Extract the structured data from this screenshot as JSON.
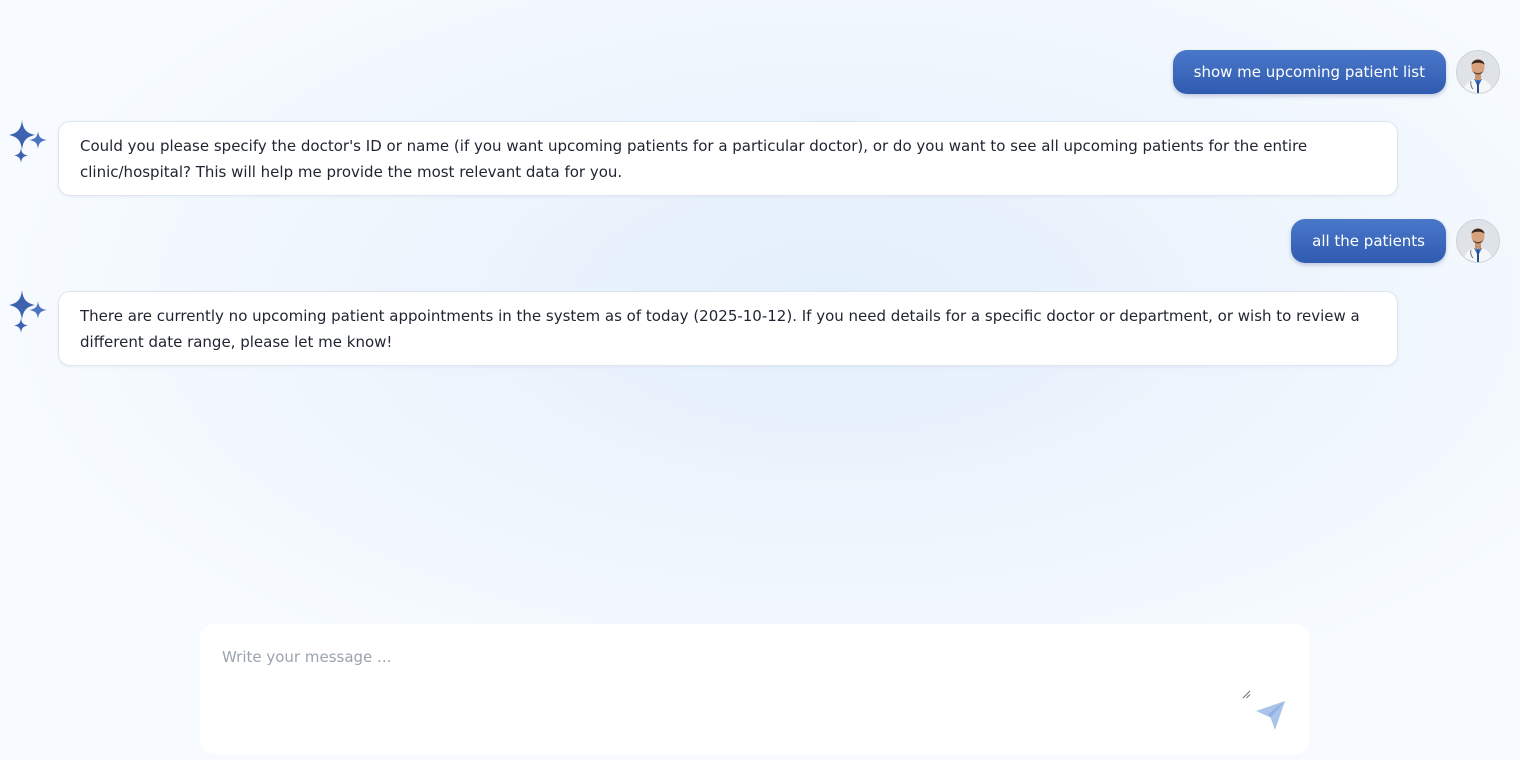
{
  "messages": [
    {
      "role": "user",
      "text": "show me upcoming patient list"
    },
    {
      "role": "assistant",
      "text": "Could you please specify the doctor's ID or name (if you want upcoming patients for a particular doctor), or do you want to see all upcoming patients for the entire clinic/hospital? This will help me provide the most relevant data for you."
    },
    {
      "role": "user",
      "text": "all the patients"
    },
    {
      "role": "assistant",
      "text": "There are currently no upcoming patient appointments in the system as of today (2025-10-12). If you need details for a specific doctor or department, or wish to review a different date range, please let me know!"
    }
  ],
  "composer": {
    "placeholder": "Write your message ...",
    "value": ""
  },
  "icons": {
    "assistant": "sparkle-icon",
    "user": "doctor-avatar",
    "send": "send-icon",
    "resize": "resize-handle-icon"
  },
  "colors": {
    "user_bubble": "#3a66ba",
    "sparkle": "#3d63b0",
    "send_icon": "#a9c3ea",
    "background": "#eaf3fc"
  }
}
